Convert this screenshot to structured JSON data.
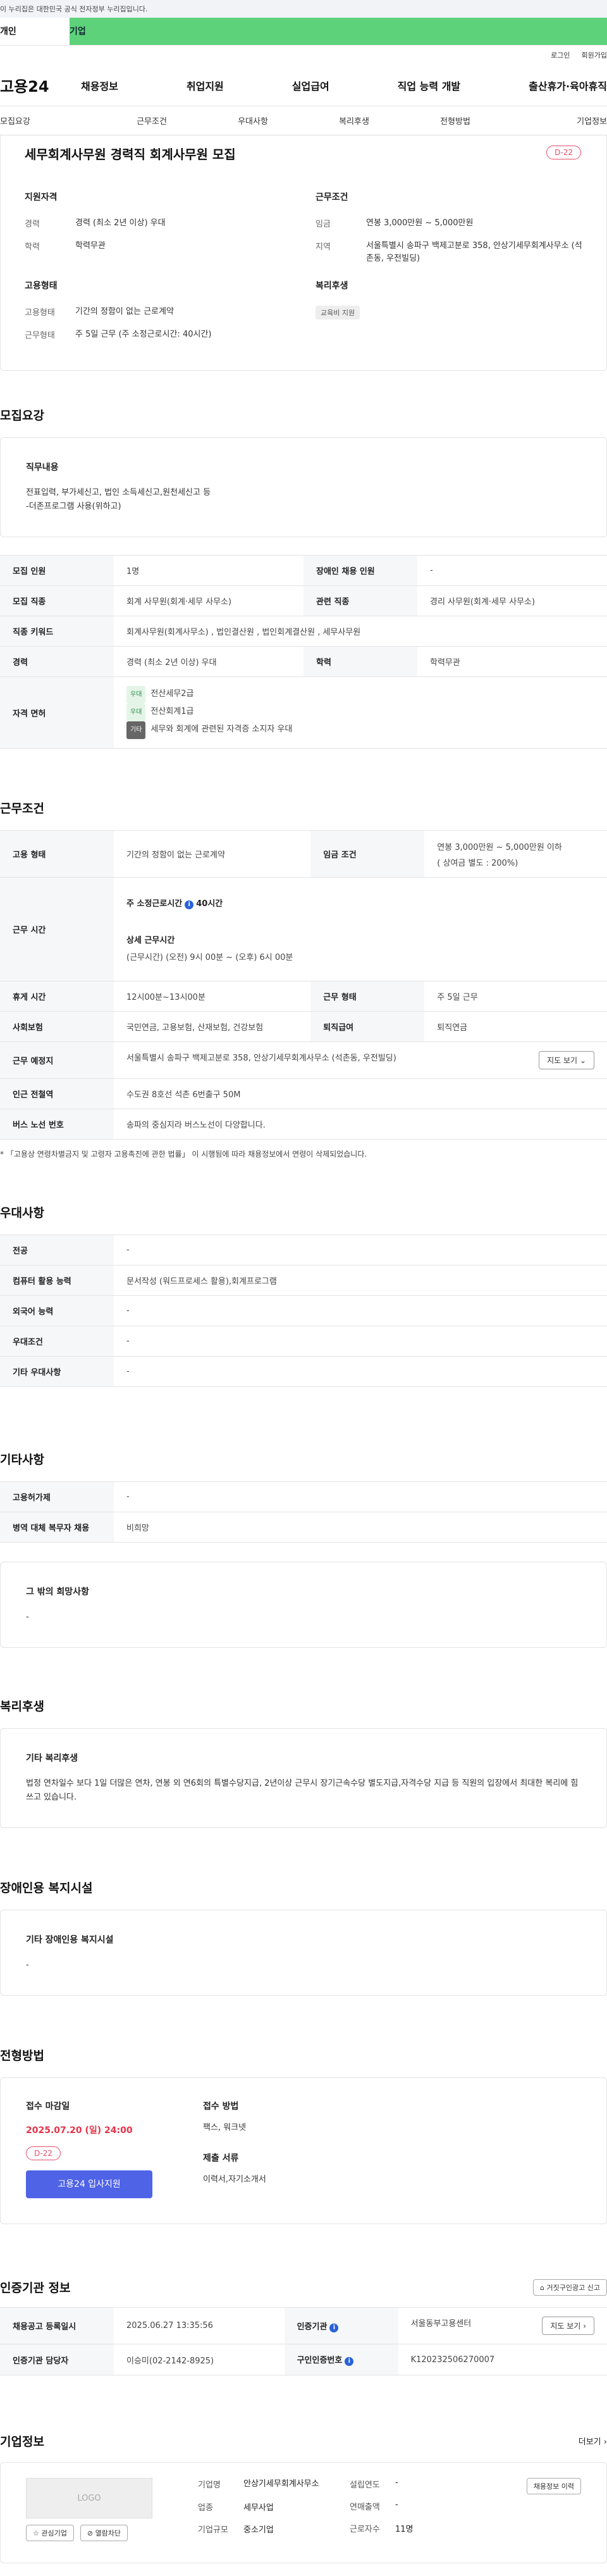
{
  "gov_banner": "이 누리집은 대한민국 공식 전자정부 누리집입니다.",
  "user_tabs": {
    "personal": "개인",
    "business": "기업"
  },
  "util": {
    "login": "로그인",
    "join": "회원가입"
  },
  "logo": "고용24",
  "gnb": [
    "채용정보",
    "취업지원",
    "실업급여",
    "직업 능력 개발",
    "출산휴가·육아휴직"
  ],
  "sub_tabs": [
    "모집요강",
    "근무조건",
    "우대사항",
    "복리후생",
    "전형방법",
    "기업정보"
  ],
  "summary": {
    "title": "세무회계사무원 경력직 회계사무원 모집",
    "dday": "D-22",
    "qual_title": "지원자격",
    "career_key": "경력",
    "career_val": "경력 (최소 2년 이상) 우대",
    "edu_key": "학력",
    "edu_val": "학력무관",
    "cond_title": "근무조건",
    "wage_key": "임금",
    "wage_val": "연봉 3,000만원 ~ 5,000만원",
    "region_key": "지역",
    "region_val": "서울특별시 송파구 백제고분로 358, 안상기세무회계사무소 (석촌동, 우전빌딩)",
    "emp_title": "고용형태",
    "emp_key": "고용형태",
    "emp_val": "기간의 정함이 없는 근로계약",
    "shape_key": "근무형태",
    "shape_val": "주 5일 근무 (주 소정근로시간: 40시간)",
    "welfare_title": "복리후생",
    "welfare_chip": "교육비 지원"
  },
  "recruit": {
    "section_title": "모집요강",
    "duty_heading": "직무내용",
    "duty_body_1": "전표입력, 부가세신고, 법인 소득세신고,원천세신고 등",
    "duty_body_2": "-더존프로그램 사용(위하고)",
    "rows": {
      "num_k": "모집 인원",
      "num_v": "1명",
      "dis_k": "장애인 채용 인원",
      "dis_v": "-",
      "job_k": "모집 직종",
      "job_v": "회계 사무원(회계·세무 사무소)",
      "rel_k": "관련 직종",
      "rel_v": "경리 사무원(회계·세무 사무소)",
      "kw_k": "직종 키워드",
      "kw_v": "회계사무원(회계사무소) , 법인결산원 , 법인회계결산원 , 세무사무원",
      "car_k": "경력",
      "car_v": "경력 (최소 2년 이상) 우대",
      "edu_k": "학력",
      "edu_v": "학력무관",
      "lic_k": "자격 면허",
      "lic_1_tag": "우대",
      "lic_1": "전산세무2급",
      "lic_2_tag": "우대",
      "lic_2": "전산회계1급",
      "lic_3_tag": "기타",
      "lic_3": "세무와 회계에 관련된 자격증 소지자 우대"
    }
  },
  "work": {
    "section_title": "근무조건",
    "type_k": "고용 형태",
    "type_v": "기간의 정함이 없는 근로계약",
    "wage_k": "임금 조건",
    "wage_v": "연봉 3,000만원 ~ 5,000만원 이하",
    "wage_sub": "( 상여금 별도 : 200%)",
    "hours_k": "근무 시간",
    "hours_title": "주 소정근로시간",
    "hours_val": "40시간",
    "detail_title": "상세 근무시간",
    "detail_val": "(근무시간) (오전) 9시 00분 ~ (오후) 6시 00분",
    "rest_k": "휴게 시간",
    "rest_v": "12시00분~13시00분",
    "shape_k": "근무 형태",
    "shape_v": "주 5일 근무",
    "ins_k": "사회보험",
    "ins_v": "국민연금, 고용보험, 산재보험, 건강보험",
    "ret_k": "퇴직급여",
    "ret_v": "퇴직연금",
    "place_k": "근무 예정지",
    "place_v": "서울특별시 송파구 백제고분로 358, 안상기세무회계사무소 (석촌동, 우전빌딩)",
    "map_btn": "지도 보기",
    "station_k": "인근 전철역",
    "station_v": "수도권 8호선 석촌 6번출구 50M",
    "bus_k": "버스 노선 번호",
    "bus_v": "송파의 중심지라 버스노선이 다양합니다.",
    "note": "* 「고용상 연령차별금지 및 고령자 고용촉진에 관한 법률」 이 시행됨에 따라 채용정보에서 연령이 삭제되었습니다."
  },
  "pref": {
    "section_title": "우대사항",
    "major_k": "전공",
    "major_v": "-",
    "pc_k": "컴퓨터 활용 능력",
    "pc_v": "문서작성 (워드프로세스 활용),회계프로그램",
    "lang_k": "외국어 능력",
    "lang_v": "-",
    "cond_k": "우대조건",
    "cond_v": "-",
    "etc_k": "기타 우대사항",
    "etc_v": "-"
  },
  "other": {
    "section_title": "기타사항",
    "ins_k": "고용허가제",
    "ins_v": "-",
    "mil_k": "병역 대체 복무자 채용",
    "mil_v": "비희망",
    "hope_heading": "그 밖의 희망사항",
    "hope_body": "-"
  },
  "welfare": {
    "section_title": "복리후생",
    "heading": "기타 복리후생",
    "body": "법정 연차일수 보다 1일 더많은 연차, 연봉 외 연6회의 특별수당지급, 2년이상 근무시 장기근속수당 별도지급,자격수당 지급 등 직원의 입장에서 최대한 복리에 힘쓰고 있습니다."
  },
  "disability": {
    "section_title": "장애인용 복지시설",
    "heading": "기타 장애인용 복지시설",
    "body": "-"
  },
  "apply": {
    "section_title": "전형방법",
    "deadline_label": "접수 마감일",
    "deadline": "2025.07.20 (일) 24:00",
    "dday": "D-22",
    "apply_btn": "고용24 입사지원",
    "method_label": "접수 방법",
    "method": "팩스, 워크넷",
    "docs_label": "제출 서류",
    "docs": "이력서,자기소개서"
  },
  "cert": {
    "section_title": "인증기관 정보",
    "report_btn": "거짓구인광고 신고",
    "reg_k": "채용공고 등록일시",
    "reg_v": "2025.06.27 13:35:56",
    "org_k": "인증기관",
    "org_v": "서울동부고용센터",
    "map_btn": "지도 보기",
    "mgr_k": "인증기관 담당자",
    "mgr_v": "이승미(02-2142-8925)",
    "num_k": "구인인증번호",
    "num_v": "K120232506270007"
  },
  "company": {
    "section_title": "기업정보",
    "more": "더보기",
    "logo_text": "LOGO",
    "interest_btn": "관심기업",
    "block_btn": "열람차단",
    "name_k": "기업명",
    "name_v": "안상기세무회계사무소",
    "year_k": "설립연도",
    "year_v": "-",
    "sales_k": "연매출액",
    "sales_v": "-",
    "biz_k": "업종",
    "biz_v": "세무사업",
    "emp_k": "근로자수",
    "emp_v": "11명",
    "size_k": "기업규모",
    "size_v": "중소기업",
    "history_btn": "채용정보 이력"
  }
}
